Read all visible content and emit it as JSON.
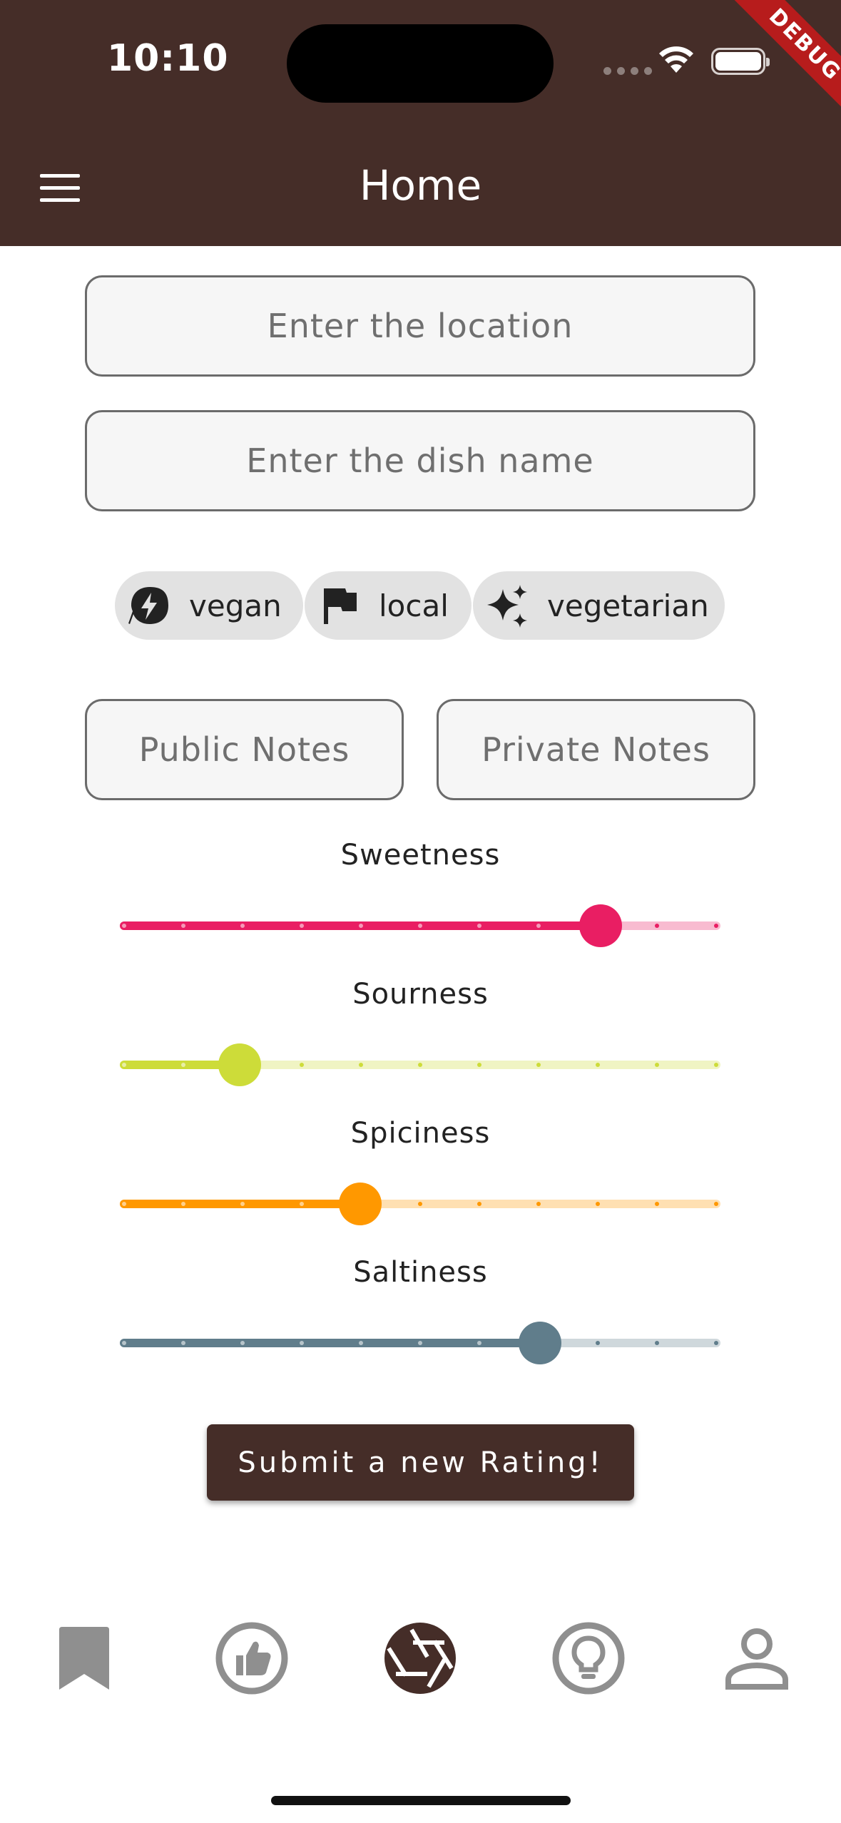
{
  "status_bar": {
    "time": "10:10"
  },
  "debug_banner": "DEBUG",
  "app_bar": {
    "title": "Home",
    "menu_icon": "hamburger-menu-icon"
  },
  "form": {
    "location_placeholder": "Enter the location",
    "dish_placeholder": "Enter the dish name"
  },
  "chips": [
    {
      "label": "vegan",
      "icon": "bolt-leaf-icon"
    },
    {
      "label": "local",
      "icon": "flag-icon"
    },
    {
      "label": "vegetarian",
      "icon": "sparkle-icon"
    }
  ],
  "notes": {
    "public_label": "Public Notes",
    "private_label": "Private Notes"
  },
  "sliders": [
    {
      "label": "Sweetness",
      "value": 8,
      "min": 0,
      "max": 10,
      "color": "#e91e63",
      "track_color": "#f8bbd0"
    },
    {
      "label": "Sourness",
      "value": 2,
      "min": 0,
      "max": 10,
      "color": "#cddc39",
      "track_color": "#f0f4c3"
    },
    {
      "label": "Spiciness",
      "value": 4,
      "min": 0,
      "max": 10,
      "color": "#ff9800",
      "track_color": "#ffe0b2"
    },
    {
      "label": "Saltiness",
      "value": 7,
      "min": 0,
      "max": 10,
      "color": "#607d8b",
      "track_color": "#cfd8dc"
    }
  ],
  "submit_label": "Submit a new Rating!",
  "bottom_nav": [
    {
      "icon": "bookmark-icon",
      "selected": false
    },
    {
      "icon": "thumb-up-icon",
      "selected": false
    },
    {
      "icon": "camera-shutter-icon",
      "selected": true
    },
    {
      "icon": "lightbulb-icon",
      "selected": false
    },
    {
      "icon": "person-icon",
      "selected": false
    }
  ],
  "colors": {
    "brand": "#452d28",
    "nav_inactive": "#8f8f8f"
  }
}
